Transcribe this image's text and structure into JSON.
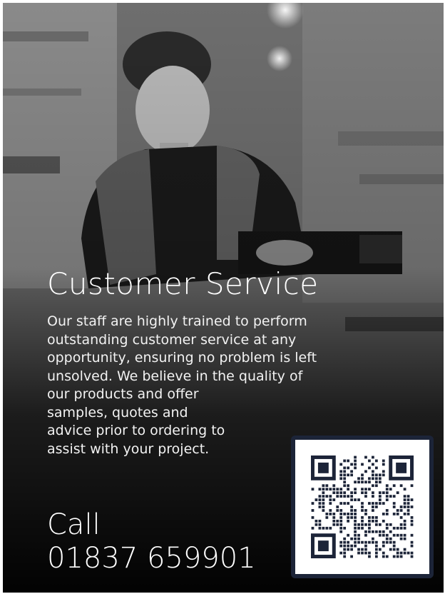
{
  "poster": {
    "title": "Customer Service",
    "body_lines": [
      "Our staff are highly trained to perform",
      "outstanding customer service at any",
      "opportunity, ensuring no problem is left",
      "unsolved. We believe in the quality of",
      "our products and offer",
      "samples, quotes and",
      "advice prior to ordering to",
      "assist with your project."
    ],
    "call_label": "Call",
    "phone_number": "01837 659901"
  },
  "colors": {
    "text": "#ffffff",
    "qr_frame": "#1c2438",
    "qr_modules": "#1c2438"
  },
  "icons": {
    "qr": "qr-code-icon"
  }
}
